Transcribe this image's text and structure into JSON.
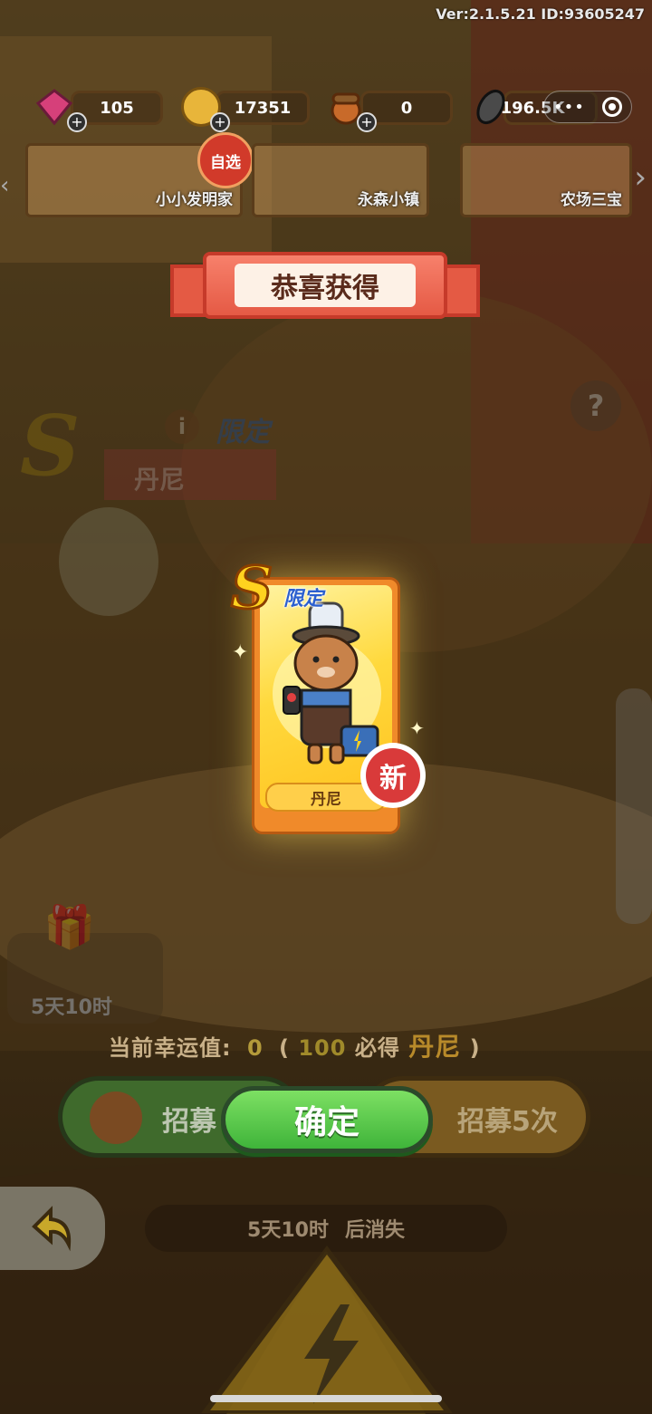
{
  "version_text": "Ver:2.1.5.21 ID:93605247",
  "resources": {
    "gems": "105",
    "coins": "17351",
    "acorns": "0",
    "seeds": "196.5K"
  },
  "banners": {
    "card1": "小小发明家",
    "card1_badge": "自选",
    "card2": "永森小镇",
    "card3": "农场三宝"
  },
  "background": {
    "rank": "S",
    "tag": "限定",
    "name": "丹尼",
    "limited_timer": "5天10时",
    "help": "?"
  },
  "popup": {
    "title": "恭喜获得",
    "card_rank": "S",
    "card_tag": "限定",
    "card_name": "丹尼",
    "new_badge": "新",
    "confirm_label": "确定"
  },
  "bottom": {
    "luck_label": "当前幸运值:",
    "luck_value": "0",
    "luck_open": "(",
    "luck_target": "100",
    "luck_must": "必得",
    "luck_name": "丹尼",
    "luck_close": ")",
    "recruit_one": "招募",
    "recruit_five": "招募5次",
    "expire_time": "5天10时",
    "expire_suffix": "后消失"
  },
  "colors": {
    "confirm_green": "#4cc244",
    "ribbon_red": "#e55a45",
    "card_gold": "#ffd93d"
  }
}
